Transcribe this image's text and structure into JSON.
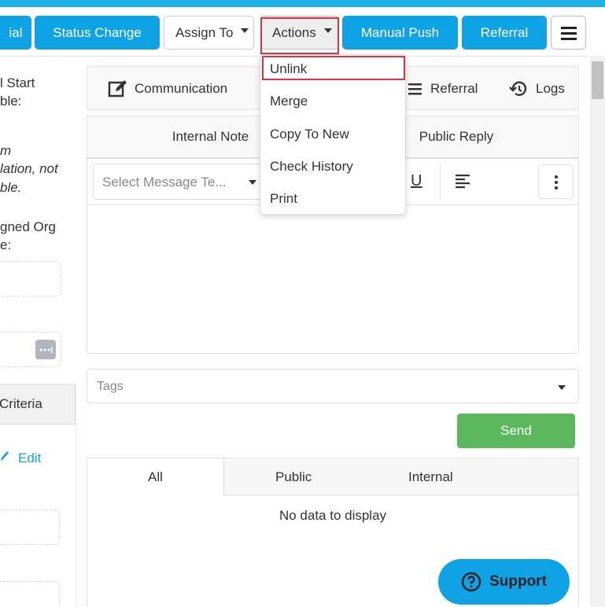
{
  "toolbar": {
    "partial_left": "ial",
    "status_change": "Status Change",
    "assign_to": "Assign To",
    "actions": "Actions",
    "manual_push": "Manual Push",
    "referral": "Referral",
    "accent_color": "#0fa3e6"
  },
  "actions_menu": {
    "items": [
      "Unlink",
      "Merge",
      "Copy To New",
      "Check History",
      "Print"
    ],
    "highlighted": "Unlink",
    "highlight_color": "#e2333c"
  },
  "left": {
    "line1": "l Start",
    "line2": "ble:",
    "ital1": "m",
    "ital2": "lation, not",
    "ital3": "ble.",
    "line3": "gned Org",
    "line4": "e:",
    "criteria": "Criteria",
    "edit": "Edit"
  },
  "tabs": {
    "communication": "Communication",
    "referral": "Referral",
    "logs": "Logs"
  },
  "subtabs": {
    "internal_note": "Internal Note",
    "public_reply": "Public Reply"
  },
  "editor": {
    "template_placeholder": "Select Message Te...",
    "underline": "U"
  },
  "tags": {
    "placeholder": "Tags"
  },
  "send": {
    "label": "Send",
    "color": "#5cb85c"
  },
  "filters": {
    "all": "All",
    "public": "Public",
    "internal": "Internal"
  },
  "list": {
    "empty": "No data to display"
  },
  "support": {
    "label": "Support"
  }
}
